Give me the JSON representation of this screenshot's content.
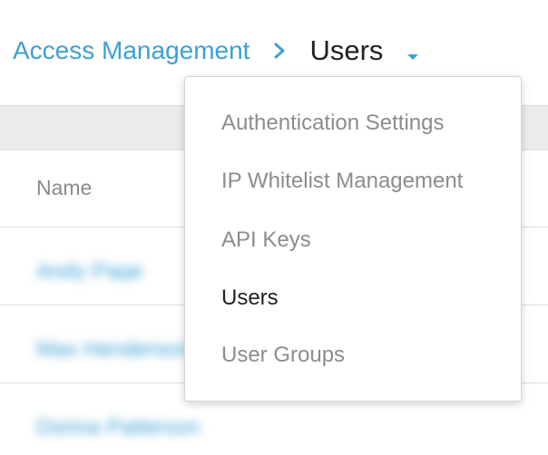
{
  "breadcrumb": {
    "parent": "Access Management",
    "current": "Users"
  },
  "table": {
    "columns": [
      "Name"
    ],
    "rows": [
      {
        "name": "Andy Page"
      },
      {
        "name": "Max Henderson"
      },
      {
        "name": "Donna Patterson"
      }
    ]
  },
  "dropdown": {
    "items": [
      {
        "label": "Authentication Settings",
        "active": false
      },
      {
        "label": "IP Whitelist Management",
        "active": false
      },
      {
        "label": "API Keys",
        "active": false
      },
      {
        "label": "Users",
        "active": true
      },
      {
        "label": "User Groups",
        "active": false
      }
    ]
  },
  "colors": {
    "link": "#3ea0d4",
    "text": "#222222",
    "muted": "#8c8c8c",
    "band": "#ececec"
  },
  "icons": {
    "separator": "chevron-right-icon",
    "caret": "caret-down-icon"
  }
}
